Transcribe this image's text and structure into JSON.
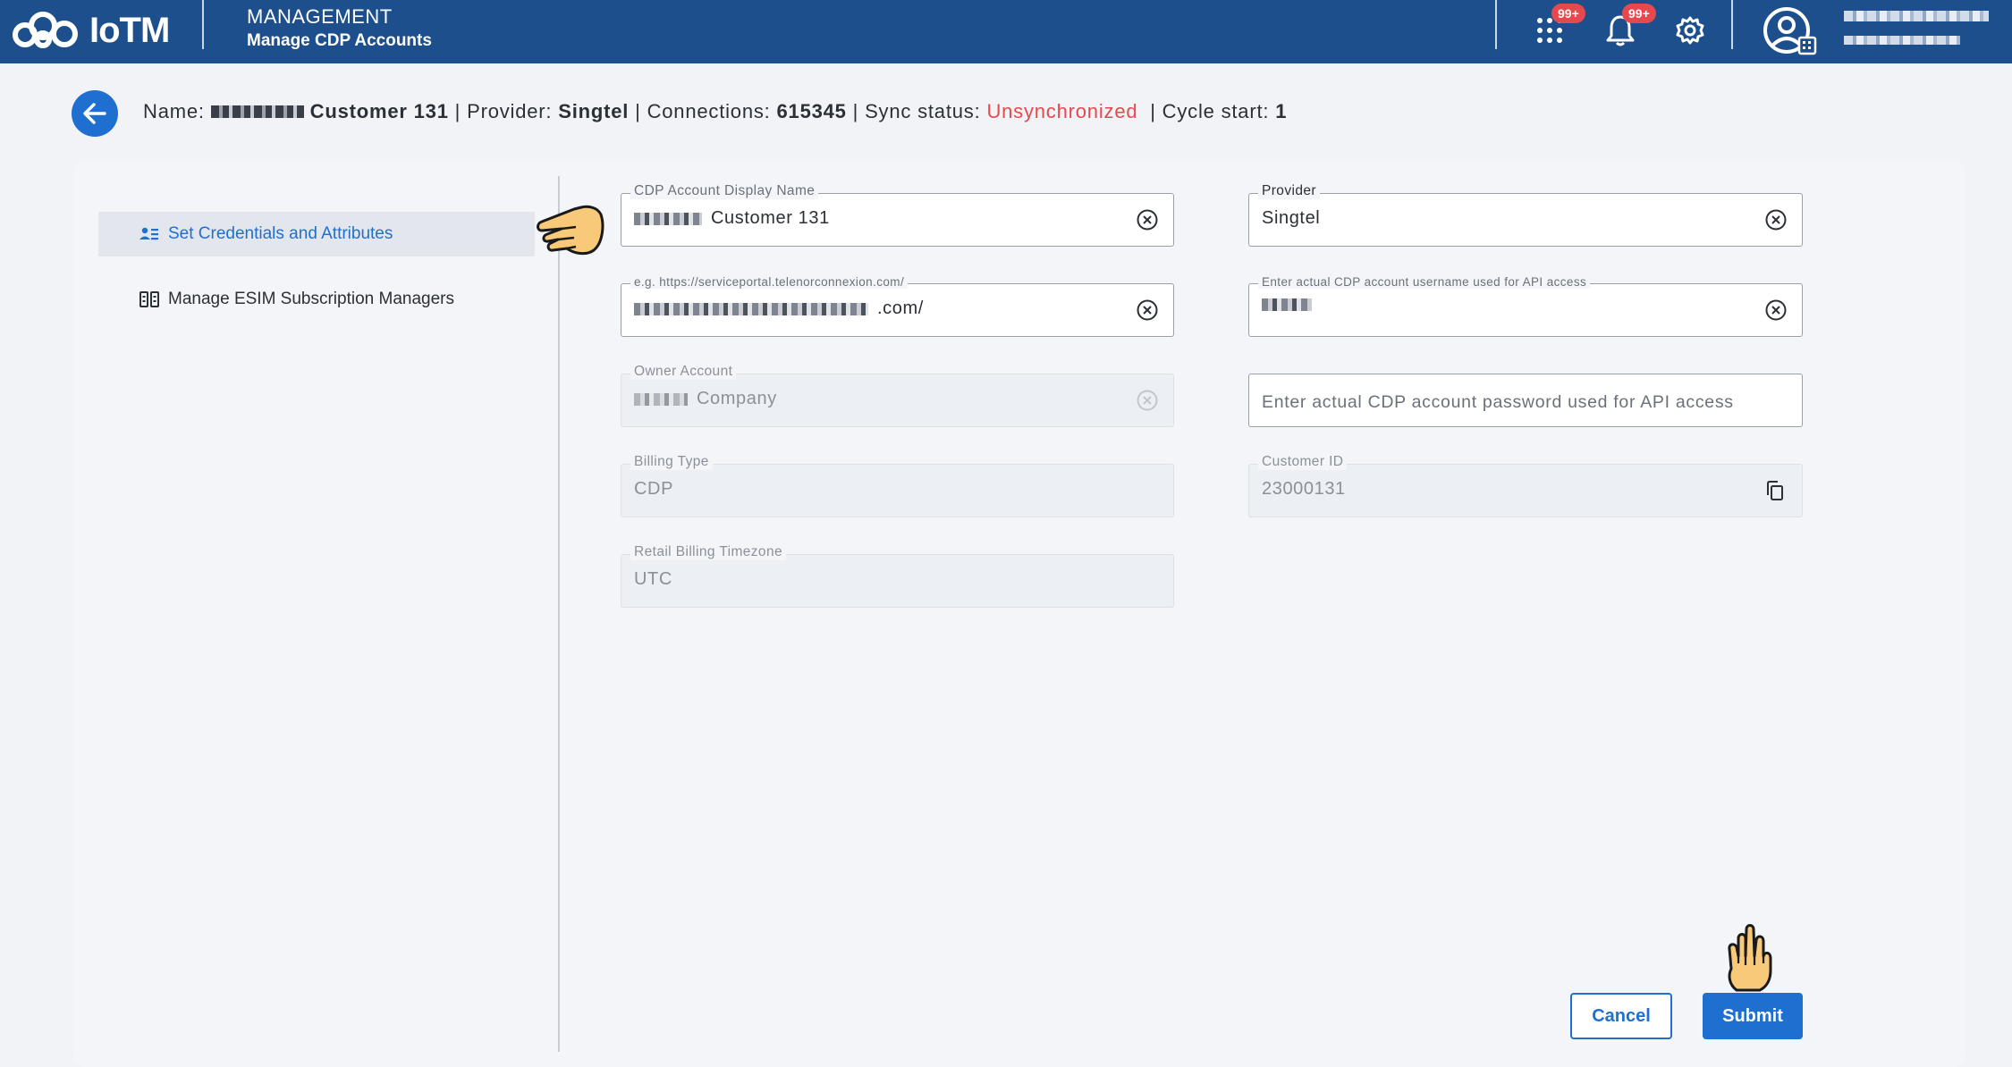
{
  "app": {
    "logo_text": "IoTM"
  },
  "header": {
    "section": "MANAGEMENT",
    "page": "Manage CDP Accounts",
    "apps_badge": "99+",
    "notifications_badge": "99+"
  },
  "info": {
    "name_label": "Name:",
    "name_value": "Customer 131",
    "provider_label": "Provider:",
    "provider_value": "Singtel",
    "connections_label": "Connections:",
    "connections_value": "615345",
    "sync_label": "Sync status:",
    "sync_value": "Unsynchronized",
    "cycle_label": "Cycle start:",
    "cycle_value": "1",
    "sep": "|"
  },
  "sidebar": {
    "items": [
      {
        "label": "Set Credentials and Attributes",
        "active": true
      },
      {
        "label": "Manage ESIM Subscription Managers",
        "active": false
      }
    ]
  },
  "form": {
    "display_name": {
      "label": "CDP Account Display Name",
      "value": "Customer 131"
    },
    "provider": {
      "label": "Provider",
      "value": "Singtel"
    },
    "url": {
      "label": "e.g. https://serviceportal.telenorconnexion.com/",
      "value": ".com/"
    },
    "username": {
      "label": "Enter actual CDP account username used for API access",
      "value": ""
    },
    "owner_account": {
      "label": "Owner Account",
      "value": "Company"
    },
    "password": {
      "placeholder": "Enter actual CDP account password used for API access"
    },
    "billing_type": {
      "label": "Billing Type",
      "value": "CDP"
    },
    "customer_id": {
      "label": "Customer ID",
      "value": "23000131"
    },
    "timezone": {
      "label": "Retail Billing Timezone",
      "value": "UTC"
    }
  },
  "buttons": {
    "cancel": "Cancel",
    "submit": "Submit"
  },
  "colors": {
    "header_bg": "#1c4f8c",
    "accent": "#1f6fd1",
    "error": "#e5484d",
    "badge": "#e5484d"
  }
}
